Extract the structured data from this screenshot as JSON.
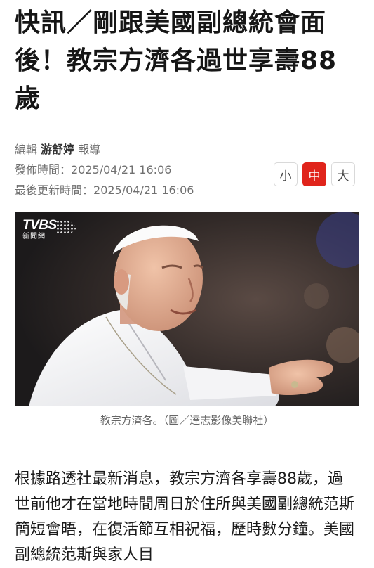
{
  "article": {
    "headline": "快訊／剛跟美國副總統會面後！教宗方濟各過世享壽88歲",
    "editor_prefix": "編輯",
    "editor_name": "游舒婷",
    "editor_suffix": "報導",
    "published_label": "發佈時間：",
    "published_time": "2025/04/21 16:06",
    "updated_label": "最後更新時間：",
    "updated_time": "2025/04/21 16:06",
    "font_size_options": [
      "小",
      "中",
      "大"
    ],
    "selected_font_size": "中",
    "image": {
      "logo_main": "TVBS",
      "logo_sub": "新聞網",
      "caption": "教宗方濟各。（圖／達志影像美聯社）"
    },
    "body": "根據路透社最新消息，教宗方濟各享壽88歲，過世前他才在當地時間周日於住所與美國副總統范斯簡短會晤，在復活節互相祝福，歷時數分鐘。美國副總統范斯與家人目"
  },
  "colors": {
    "accent": "#e0241b",
    "headline": "#161616",
    "meta": "#707070",
    "caption": "#666666"
  }
}
